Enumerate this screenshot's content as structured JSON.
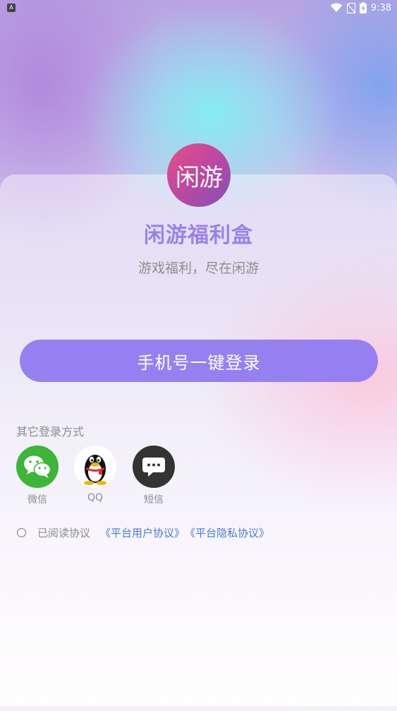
{
  "status_bar": {
    "left_badge": "A",
    "time": "9:38",
    "icons": [
      "wifi-icon",
      "no-sim-icon",
      "battery-charging-icon"
    ]
  },
  "app": {
    "logo_text": "闲游",
    "name": "闲游福利盒",
    "slogan": "游戏福利，尽在闲游"
  },
  "login": {
    "primary_button": "手机号一键登录",
    "other_title": "其它登录方式",
    "options": [
      {
        "label": "微信",
        "icon": "wechat-icon",
        "color": "#3cb538"
      },
      {
        "label": "QQ",
        "icon": "qq-penguin-icon",
        "color": "#ffffff"
      },
      {
        "label": "短信",
        "icon": "sms-icon",
        "color": "#333333"
      }
    ]
  },
  "agreement": {
    "prefix": "已阅读协议",
    "user_agreement": "《平台用户协议》",
    "privacy_agreement": "《平台隐私协议》"
  },
  "colors": {
    "accent": "#9580f2",
    "title": "#9a82ea",
    "link": "#4a7ad8"
  }
}
